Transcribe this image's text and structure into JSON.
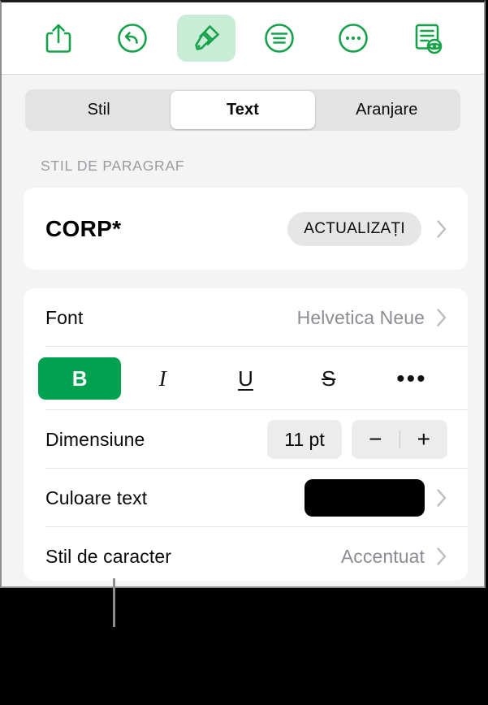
{
  "toolbar": {
    "buttons": [
      {
        "name": "share-icon",
        "label": "Partajați",
        "active": false
      },
      {
        "name": "undo-icon",
        "label": "Anulați",
        "active": false
      },
      {
        "name": "paintbrush-icon",
        "label": "Format",
        "active": true
      },
      {
        "name": "format-list-icon",
        "label": "Inserați",
        "active": false
      },
      {
        "name": "more-icon",
        "label": "Mai multe",
        "active": false
      },
      {
        "name": "document-eye-icon",
        "label": "Document",
        "active": false
      }
    ]
  },
  "tabs": [
    {
      "label": "Stil",
      "selected": false
    },
    {
      "label": "Text",
      "selected": true
    },
    {
      "label": "Aranjare",
      "selected": false
    }
  ],
  "sections": {
    "paragraph_style_header": "STIL DE PARAGRAF"
  },
  "paragraph_style": {
    "name": "CORP*",
    "update_label": "ACTUALIZAȚI",
    "chevron": "chevron-right-icon"
  },
  "text_settings": {
    "font": {
      "label": "Font",
      "value": "Helvetica Neue"
    },
    "style_buttons": [
      {
        "name": "bold-button",
        "glyph": "B",
        "active": true
      },
      {
        "name": "italic-button",
        "glyph": "I",
        "active": false
      },
      {
        "name": "underline-button",
        "glyph": "U",
        "active": false
      },
      {
        "name": "strikethrough-button",
        "glyph": "S",
        "active": false
      },
      {
        "name": "more-text-options-button",
        "glyph": "•••",
        "active": false
      }
    ],
    "size": {
      "label": "Dimensiune",
      "value": "11 pt",
      "decrement": "−",
      "increment": "+"
    },
    "text_color": {
      "label": "Culoare text",
      "swatch_color": "#000000"
    },
    "character_style": {
      "label": "Stil de caracter",
      "value": "Accentuat"
    }
  },
  "colors": {
    "accent_green": "#01a24f",
    "accent_green_light": "#c9ecd6",
    "panel_background": "#f4f4f4",
    "card_background": "#ffffff",
    "secondary_text": "#8c8c92",
    "header_text": "#9a9a9f"
  }
}
